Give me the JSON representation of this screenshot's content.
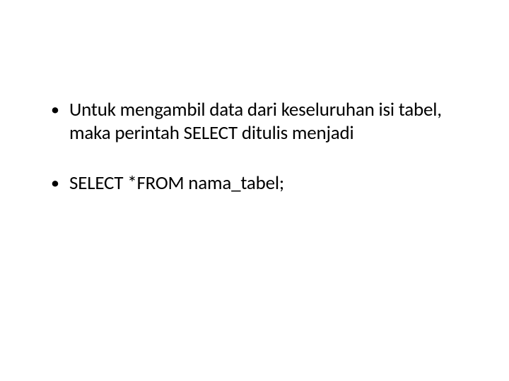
{
  "bullets": [
    "Untuk mengambil data dari keseluruhan isi tabel, maka perintah SELECT ditulis menjadi",
    "SELECT *FROM nama_tabel;"
  ]
}
